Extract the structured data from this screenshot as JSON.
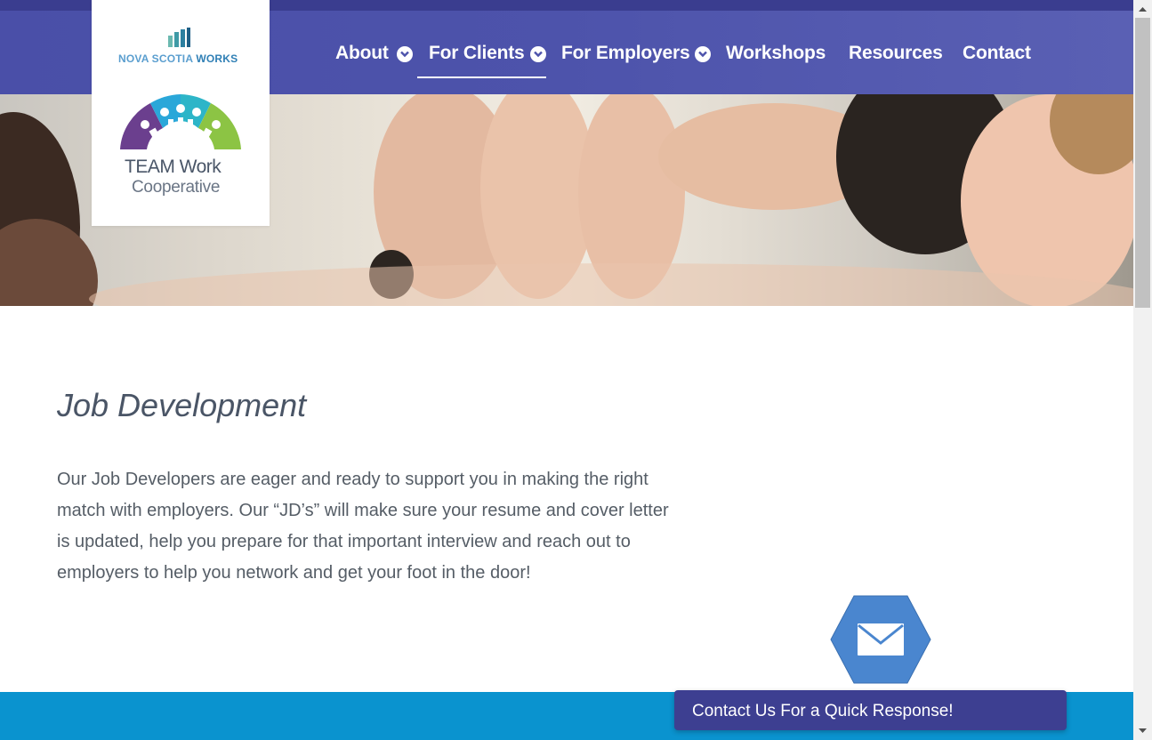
{
  "brand": {
    "top_logo_text_1": "NOVA SCOTIA",
    "top_logo_text_2": "WORKS",
    "team_title": "TEAM Work",
    "team_subtitle": "Cooperative"
  },
  "nav": {
    "items": [
      {
        "label": "About",
        "has_dropdown": true
      },
      {
        "label": "For Clients",
        "has_dropdown": true,
        "active": true
      },
      {
        "label": "For Employers",
        "has_dropdown": true
      },
      {
        "label": "Workshops",
        "has_dropdown": false
      },
      {
        "label": "Resources",
        "has_dropdown": false
      },
      {
        "label": "Contact",
        "has_dropdown": false
      }
    ]
  },
  "main": {
    "title": "Job Development",
    "body": "Our Job Developers are eager and ready to support you in making the right match with employers.  Our “JD’s” will make sure your resume and cover letter is updated, help you prepare for that important interview and reach out to employers to help you network and get your foot in the door!"
  },
  "contact_widget": {
    "label": "Contact Us For a Quick Response!",
    "icon": "envelope-icon"
  },
  "colors": {
    "nav_bg": "#4d53ab",
    "footer_bg": "#0a93cf",
    "contact_bar_bg": "#3d3f91",
    "hex_bg": "#4a86cf"
  }
}
